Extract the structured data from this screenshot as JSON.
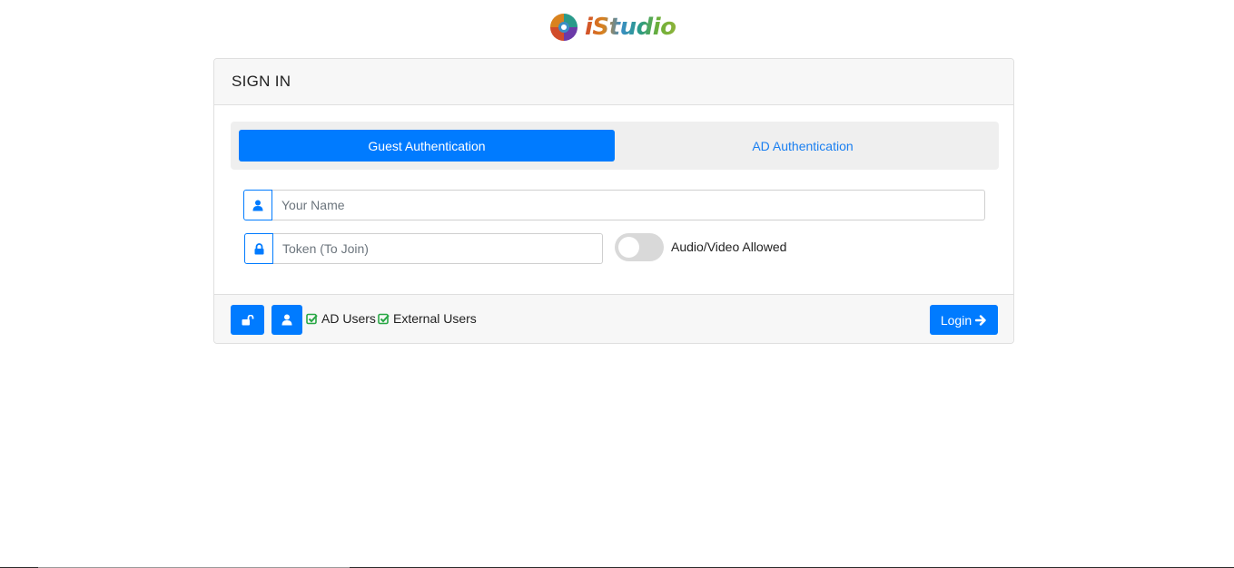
{
  "brand": {
    "name": "iStudio"
  },
  "card": {
    "title": "SIGN IN"
  },
  "tabs": [
    {
      "label": "Guest Authentication",
      "active": true
    },
    {
      "label": "AD Authentication",
      "active": false
    }
  ],
  "form": {
    "name_placeholder": "Your Name",
    "name_value": "",
    "token_placeholder": "Token (To Join)",
    "token_value": "",
    "av_toggle_label": "Audio/Video Allowed",
    "av_toggle_on": false
  },
  "footer": {
    "checks": [
      {
        "label": "AD Users",
        "checked": true
      },
      {
        "label": "External Users",
        "checked": true
      }
    ],
    "login_label": "Login"
  },
  "icons": {
    "name_addon": "user-icon",
    "token_addon": "lock-icon",
    "unlock_button": "unlock-icon",
    "user_button": "user-icon",
    "check": "check-square-icon",
    "login_arrow": "arrow-right-icon"
  },
  "colors": {
    "primary": "#007bff",
    "link": "#1a7ff0",
    "check_green": "#28a745",
    "toggle_off": "#d9d9d9"
  }
}
